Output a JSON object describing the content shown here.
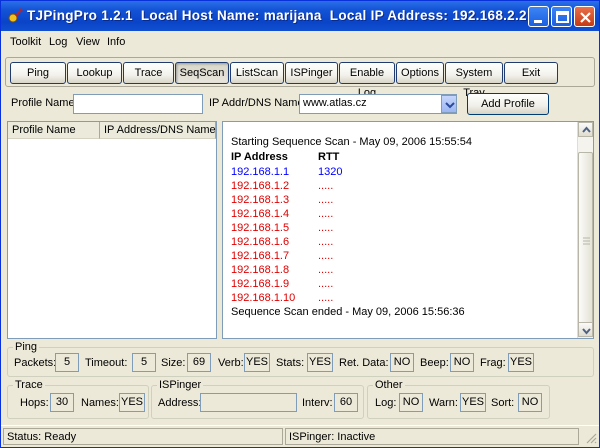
{
  "window": {
    "title": "TJPingPro 1.2.1  Local Host Name: marijana  Local IP Address: 192.168.2.2"
  },
  "menu": [
    "Toolkit",
    "Log",
    "View",
    "Info"
  ],
  "toolbar": {
    "buttons": [
      "Ping",
      "Lookup",
      "Trace",
      "SeqScan",
      "ListScan",
      "ISPinger",
      "Enable Log",
      "Options",
      "System Tray",
      "Exit"
    ],
    "active": "SeqScan"
  },
  "profile": {
    "name_label": "Profile Name:",
    "name_value": "",
    "addr_label": "IP Addr/DNS Name:",
    "addr_value": "www.atlas.cz",
    "add_button": "Add Profile"
  },
  "profile_list": {
    "columns": [
      "Profile Name",
      "IP Address/DNS Name"
    ],
    "rows": []
  },
  "output": {
    "start_line": "Starting Sequence Scan - May 09, 2006  15:55:54",
    "header_ip": "IP Address",
    "header_rtt": "RTT",
    "results": [
      {
        "ip": "192.168.1.1",
        "rtt": "1320",
        "ok": true
      },
      {
        "ip": "192.168.1.2",
        "rtt": ".....",
        "ok": false
      },
      {
        "ip": "192.168.1.3",
        "rtt": ".....",
        "ok": false
      },
      {
        "ip": "192.168.1.4",
        "rtt": ".....",
        "ok": false
      },
      {
        "ip": "192.168.1.5",
        "rtt": ".....",
        "ok": false
      },
      {
        "ip": "192.168.1.6",
        "rtt": ".....",
        "ok": false
      },
      {
        "ip": "192.168.1.7",
        "rtt": ".....",
        "ok": false
      },
      {
        "ip": "192.168.1.8",
        "rtt": ".....",
        "ok": false
      },
      {
        "ip": "192.168.1.9",
        "rtt": ".....",
        "ok": false
      },
      {
        "ip": "192.168.1.10",
        "rtt": ".....",
        "ok": false
      }
    ],
    "end_line": "Sequence Scan ended - May 09, 2006  15:56:36",
    "colors": {
      "ok": "#0000ff",
      "fail": "#e00000"
    }
  },
  "ping": {
    "title": "Ping",
    "packets_label": "Packets:",
    "packets": "5",
    "timeout_label": "Timeout:",
    "timeout": "5",
    "size_label": "Size:",
    "size": "69",
    "verb_label": "Verb:",
    "verb": "YES",
    "stats_label": "Stats:",
    "stats": "YES",
    "retdata_label": "Ret. Data:",
    "retdata": "NO",
    "beep_label": "Beep:",
    "beep": "NO",
    "frag_label": "Frag:",
    "frag": "YES"
  },
  "trace": {
    "title": "Trace",
    "hops_label": "Hops:",
    "hops": "30",
    "names_label": "Names:",
    "names": "YES"
  },
  "ispinger": {
    "title": "ISPinger",
    "address_label": "Address:",
    "address": "",
    "interv_label": "Interv:",
    "interv": "60"
  },
  "other": {
    "title": "Other",
    "log_label": "Log:",
    "log": "NO",
    "warn_label": "Warn:",
    "warn": "YES",
    "sort_label": "Sort:",
    "sort": "NO"
  },
  "status": {
    "left": "Status: Ready",
    "right": "ISPinger: Inactive"
  }
}
